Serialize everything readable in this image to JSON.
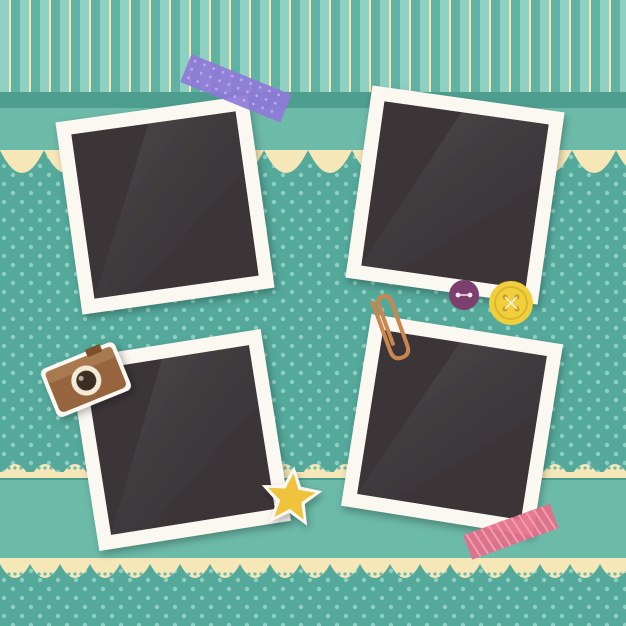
{
  "colors": {
    "background_teal": "#54a99b",
    "stripe_light": "#8fd0c0",
    "stripe_mid": "#5eb3a5",
    "cream": "#f5e7b8",
    "polka_dot": "#8dd0c2",
    "band_teal": "#6cbaa8",
    "band_dark": "#4e9e90",
    "frame_white": "#fbf7f1",
    "photo_dark": "#3a3638",
    "tape_purple": "#8f79d8",
    "tape_pink": "#e46e8a",
    "button_purple": "#7c3f6e",
    "button_yellow": "#f1cf3c",
    "star_yellow": "#f1c23b",
    "paperclip_orange": "#c9874f",
    "camera_brown": "#96653e"
  },
  "decorations": {
    "photo_frames": [
      "empty-photo-frame-1",
      "empty-photo-frame-2",
      "empty-photo-frame-3",
      "empty-photo-frame-4"
    ],
    "icons": [
      "washi-tape-purple",
      "washi-tape-pink",
      "button-purple",
      "button-yellow",
      "camera-sticker-icon",
      "star-sticker-icon",
      "paperclip-icon"
    ]
  }
}
